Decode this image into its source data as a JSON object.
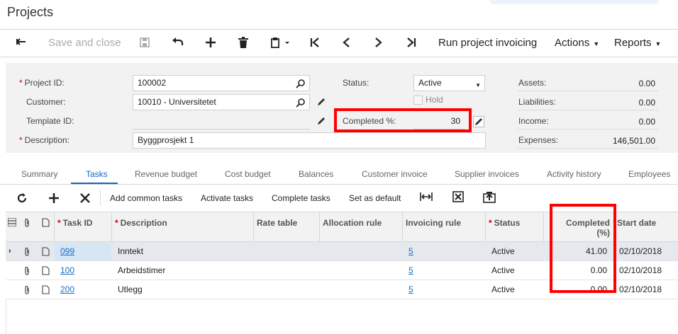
{
  "page": {
    "title": "Projects"
  },
  "toolbar": {
    "save_close": "Save and close",
    "run_invoicing": "Run project invoicing",
    "actions": "Actions",
    "reports": "Reports",
    "icons": [
      "back-arrow-icon",
      "save-icon",
      "undo-icon",
      "add-icon",
      "delete-icon",
      "clipboard-icon",
      "first-icon",
      "previous-icon",
      "next-icon",
      "last-icon"
    ]
  },
  "form": {
    "project_id": {
      "label": "Project ID:",
      "value": "100002"
    },
    "customer": {
      "label": "Customer:",
      "value": "10010 - Universitetet"
    },
    "template_id": {
      "label": "Template ID:",
      "value": ""
    },
    "description": {
      "label": "Description:",
      "value": "Byggprosjekt 1"
    },
    "status": {
      "label": "Status:",
      "value": "Active"
    },
    "hold": {
      "label": "Hold",
      "checked": false
    },
    "completed": {
      "label": "Completed %:",
      "value": "30"
    }
  },
  "summary": {
    "assets": {
      "label": "Assets:",
      "value": "0.00"
    },
    "liabilities": {
      "label": "Liabilities:",
      "value": "0.00"
    },
    "income": {
      "label": "Income:",
      "value": "0.00"
    },
    "expenses": {
      "label": "Expenses:",
      "value": "146,501.00"
    }
  },
  "tabs": [
    "Summary",
    "Tasks",
    "Revenue budget",
    "Cost budget",
    "Balances",
    "Customer invoice",
    "Supplier invoices",
    "Activity history",
    "Employees"
  ],
  "active_tab": "Tasks",
  "grid_toolbar": {
    "add_common": "Add common tasks",
    "activate": "Activate tasks",
    "complete": "Complete tasks",
    "set_default": "Set as default"
  },
  "grid": {
    "headers": {
      "task_id": "Task ID",
      "description": "Description",
      "rate_table": "Rate table",
      "allocation_rule": "Allocation rule",
      "invoicing_rule": "Invoicing rule",
      "status": "Status",
      "completed": "Completed (%)",
      "start_date": "Start date"
    },
    "rows": [
      {
        "task_id": "099",
        "description": "Inntekt",
        "invoicing_rule": "5",
        "status": "Active",
        "completed": "41.00",
        "start_date": "02/10/2018"
      },
      {
        "task_id": "100",
        "description": "Arbeidstimer",
        "invoicing_rule": "5",
        "status": "Active",
        "completed": "0.00",
        "start_date": "02/10/2018"
      },
      {
        "task_id": "200",
        "description": "Utlegg",
        "invoicing_rule": "5",
        "status": "Active",
        "completed": "0.00",
        "start_date": "02/10/2018"
      }
    ]
  },
  "highlight_color": "#ff0000"
}
